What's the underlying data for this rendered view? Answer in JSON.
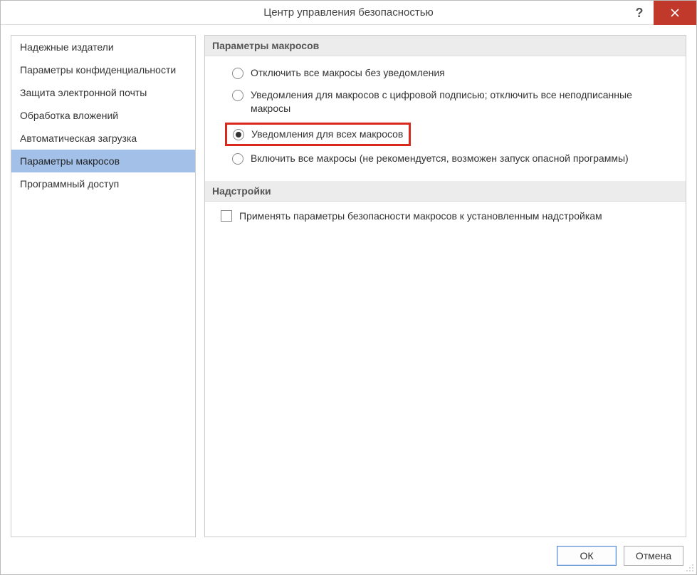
{
  "window": {
    "title": "Центр управления безопасностью"
  },
  "sidebar": {
    "items": [
      {
        "label": "Надежные издатели",
        "selected": false
      },
      {
        "label": "Параметры конфиденциальности",
        "selected": false
      },
      {
        "label": "Защита электронной почты",
        "selected": false
      },
      {
        "label": "Обработка вложений",
        "selected": false
      },
      {
        "label": "Автоматическая загрузка",
        "selected": false
      },
      {
        "label": "Параметры макросов",
        "selected": true
      },
      {
        "label": "Программный доступ",
        "selected": false
      }
    ]
  },
  "content": {
    "section_macros": {
      "title": "Параметры макросов",
      "options": [
        {
          "label": "Отключить все макросы без уведомления",
          "checked": false,
          "highlighted": false
        },
        {
          "label": "Уведомления для макросов с цифровой подписью; отключить все неподписанные макросы",
          "checked": false,
          "highlighted": false
        },
        {
          "label": "Уведомления для всех макросов",
          "checked": true,
          "highlighted": true
        },
        {
          "label": "Включить все макросы (не рекомендуется, возможен запуск опасной программы)",
          "checked": false,
          "highlighted": false
        }
      ]
    },
    "section_addins": {
      "title": "Надстройки",
      "checkbox": {
        "label": "Применять параметры безопасности макросов к установленным надстройкам",
        "checked": false
      }
    }
  },
  "buttons": {
    "ok": "ОК",
    "cancel": "Отмена"
  }
}
